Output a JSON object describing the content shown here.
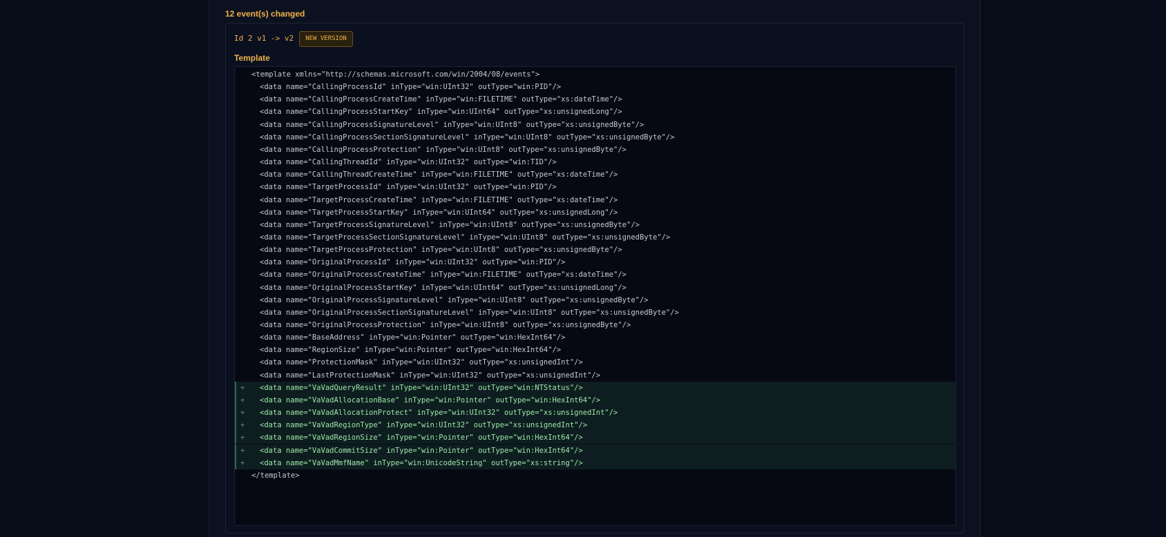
{
  "header": {
    "changed_summary": "12 event(s) changed"
  },
  "event": {
    "id_label": "Id 2 v1 -> v2",
    "badge": "NEW VERSION",
    "section_label": "Template"
  },
  "colors": {
    "accent": "#f0b24a",
    "added_text": "#9ee6a8",
    "added_bg": "#0e1e20",
    "background": "#080c18"
  },
  "template_lines": [
    {
      "text": "<template xmlns=\"http://schemas.microsoft.com/win/2004/08/events\">",
      "indent": 0,
      "added": false
    },
    {
      "text": "<data name=\"CallingProcessId\" inType=\"win:UInt32\" outType=\"win:PID\"/>",
      "indent": 1,
      "added": false
    },
    {
      "text": "<data name=\"CallingProcessCreateTime\" inType=\"win:FILETIME\" outType=\"xs:dateTime\"/>",
      "indent": 1,
      "added": false
    },
    {
      "text": "<data name=\"CallingProcessStartKey\" inType=\"win:UInt64\" outType=\"xs:unsignedLong\"/>",
      "indent": 1,
      "added": false
    },
    {
      "text": "<data name=\"CallingProcessSignatureLevel\" inType=\"win:UInt8\" outType=\"xs:unsignedByte\"/>",
      "indent": 1,
      "added": false
    },
    {
      "text": "<data name=\"CallingProcessSectionSignatureLevel\" inType=\"win:UInt8\" outType=\"xs:unsignedByte\"/>",
      "indent": 1,
      "added": false
    },
    {
      "text": "<data name=\"CallingProcessProtection\" inType=\"win:UInt8\" outType=\"xs:unsignedByte\"/>",
      "indent": 1,
      "added": false
    },
    {
      "text": "<data name=\"CallingThreadId\" inType=\"win:UInt32\" outType=\"win:TID\"/>",
      "indent": 1,
      "added": false
    },
    {
      "text": "<data name=\"CallingThreadCreateTime\" inType=\"win:FILETIME\" outType=\"xs:dateTime\"/>",
      "indent": 1,
      "added": false
    },
    {
      "text": "<data name=\"TargetProcessId\" inType=\"win:UInt32\" outType=\"win:PID\"/>",
      "indent": 1,
      "added": false
    },
    {
      "text": "<data name=\"TargetProcessCreateTime\" inType=\"win:FILETIME\" outType=\"xs:dateTime\"/>",
      "indent": 1,
      "added": false
    },
    {
      "text": "<data name=\"TargetProcessStartKey\" inType=\"win:UInt64\" outType=\"xs:unsignedLong\"/>",
      "indent": 1,
      "added": false
    },
    {
      "text": "<data name=\"TargetProcessSignatureLevel\" inType=\"win:UInt8\" outType=\"xs:unsignedByte\"/>",
      "indent": 1,
      "added": false
    },
    {
      "text": "<data name=\"TargetProcessSectionSignatureLevel\" inType=\"win:UInt8\" outType=\"xs:unsignedByte\"/>",
      "indent": 1,
      "added": false
    },
    {
      "text": "<data name=\"TargetProcessProtection\" inType=\"win:UInt8\" outType=\"xs:unsignedByte\"/>",
      "indent": 1,
      "added": false
    },
    {
      "text": "<data name=\"OriginalProcessId\" inType=\"win:UInt32\" outType=\"win:PID\"/>",
      "indent": 1,
      "added": false
    },
    {
      "text": "<data name=\"OriginalProcessCreateTime\" inType=\"win:FILETIME\" outType=\"xs:dateTime\"/>",
      "indent": 1,
      "added": false
    },
    {
      "text": "<data name=\"OriginalProcessStartKey\" inType=\"win:UInt64\" outType=\"xs:unsignedLong\"/>",
      "indent": 1,
      "added": false
    },
    {
      "text": "<data name=\"OriginalProcessSignatureLevel\" inType=\"win:UInt8\" outType=\"xs:unsignedByte\"/>",
      "indent": 1,
      "added": false
    },
    {
      "text": "<data name=\"OriginalProcessSectionSignatureLevel\" inType=\"win:UInt8\" outType=\"xs:unsignedByte\"/>",
      "indent": 1,
      "added": false
    },
    {
      "text": "<data name=\"OriginalProcessProtection\" inType=\"win:UInt8\" outType=\"xs:unsignedByte\"/>",
      "indent": 1,
      "added": false
    },
    {
      "text": "<data name=\"BaseAddress\" inType=\"win:Pointer\" outType=\"win:HexInt64\"/>",
      "indent": 1,
      "added": false
    },
    {
      "text": "<data name=\"RegionSize\" inType=\"win:Pointer\" outType=\"win:HexInt64\"/>",
      "indent": 1,
      "added": false
    },
    {
      "text": "<data name=\"ProtectionMask\" inType=\"win:UInt32\" outType=\"xs:unsignedInt\"/>",
      "indent": 1,
      "added": false
    },
    {
      "text": "<data name=\"LastProtectionMask\" inType=\"win:UInt32\" outType=\"xs:unsignedInt\"/>",
      "indent": 1,
      "added": false
    },
    {
      "text": "<data name=\"VaVadQueryResult\" inType=\"win:UInt32\" outType=\"win:NTStatus\"/>",
      "indent": 1,
      "added": true
    },
    {
      "text": "<data name=\"VaVadAllocationBase\" inType=\"win:Pointer\" outType=\"win:HexInt64\"/>",
      "indent": 1,
      "added": true
    },
    {
      "text": "<data name=\"VaVadAllocationProtect\" inType=\"win:UInt32\" outType=\"xs:unsignedInt\"/>",
      "indent": 1,
      "added": true
    },
    {
      "text": "<data name=\"VaVadRegionType\" inType=\"win:UInt32\" outType=\"xs:unsignedInt\"/>",
      "indent": 1,
      "added": true
    },
    {
      "text": "<data name=\"VaVadRegionSize\" inType=\"win:Pointer\" outType=\"win:HexInt64\"/>",
      "indent": 1,
      "added": true
    },
    {
      "text": "<data name=\"VaVadCommitSize\" inType=\"win:Pointer\" outType=\"win:HexInt64\"/>",
      "indent": 1,
      "added": true
    },
    {
      "text": "<data name=\"VaVadMmfName\" inType=\"win:UnicodeString\" outType=\"xs:string\"/>",
      "indent": 1,
      "added": true
    },
    {
      "text": "</template>",
      "indent": 0,
      "added": false
    }
  ],
  "added_marker": "+"
}
